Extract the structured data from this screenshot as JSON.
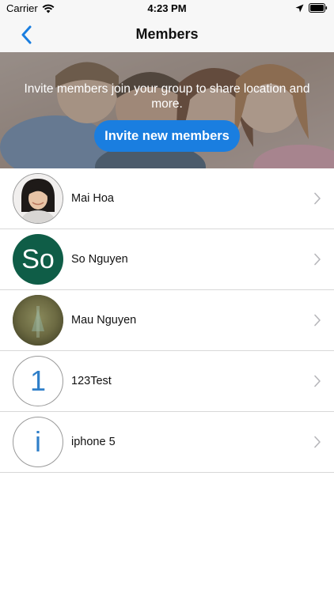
{
  "status_bar": {
    "carrier": "Carrier",
    "time": "4:23 PM"
  },
  "nav": {
    "title": "Members",
    "back_icon": "chevron-left-icon"
  },
  "banner": {
    "message": "Invite members join your group to share location and more.",
    "invite_button_label": "Invite new members"
  },
  "members": [
    {
      "name": "Mai Hoa",
      "avatar_type": "photo",
      "avatar_text": ""
    },
    {
      "name": "So Nguyen",
      "avatar_type": "initials-filled",
      "avatar_text": "So"
    },
    {
      "name": "Mau Nguyen",
      "avatar_type": "photo",
      "avatar_text": ""
    },
    {
      "name": "123Test",
      "avatar_type": "initials-outline",
      "avatar_text": "1"
    },
    {
      "name": "iphone 5",
      "avatar_type": "initials-outline",
      "avatar_text": "i"
    }
  ],
  "colors": {
    "accent": "#1a7ee0",
    "avatar_filled_bg": "#0f5d47",
    "initials_blue": "#2f7fc9"
  }
}
